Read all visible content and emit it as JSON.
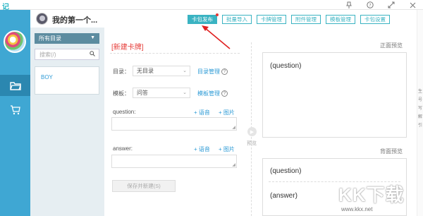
{
  "app": {
    "logo_text": "记",
    "title": "我的第一个..."
  },
  "window_controls": [
    "pin-icon",
    "help-icon",
    "expand-icon",
    "close-icon"
  ],
  "toolbar": {
    "buttons": [
      {
        "label": "卡包发布",
        "primary": true
      },
      {
        "label": "批量导入"
      },
      {
        "label": "卡牌管理"
      },
      {
        "label": "附件管理"
      },
      {
        "label": "模板管理"
      },
      {
        "label": "卡包设置"
      }
    ]
  },
  "sidebar": {
    "items": [
      {
        "icon": "folder-icon",
        "active": true
      },
      {
        "icon": "cart-icon",
        "active": false
      }
    ]
  },
  "directory": {
    "select_label": "所有目录",
    "search_placeholder": "搜索(/)",
    "items": [
      "BOY"
    ]
  },
  "form": {
    "heading": "[新建卡牌]",
    "dir_label": "目录：",
    "dir_value": "无目录",
    "dir_manage": "目录管理",
    "template_label": "模板：",
    "template_value": "问答",
    "template_manage": "模板管理",
    "question_label": "question:",
    "answer_label": "answer:",
    "voice": "+ 语音",
    "image": "+ 图片",
    "save_button": "保存并新建(S)"
  },
  "preview": {
    "toggle_label": "预览",
    "front_title": "正面预览",
    "back_title": "背面预览",
    "front_text": "(question)",
    "back_question": "(question)",
    "back_answer": "(answer)"
  },
  "right_strip": [
    "生",
    "号",
    "写",
    "解",
    "引"
  ],
  "watermark": {
    "text": "KK下载",
    "url": "www.kkx.net"
  },
  "colors": {
    "accent": "#3ab3c2",
    "sidebar": "#3fa7d3",
    "heading_red": "#e53935",
    "link": "#2e9bd6"
  }
}
